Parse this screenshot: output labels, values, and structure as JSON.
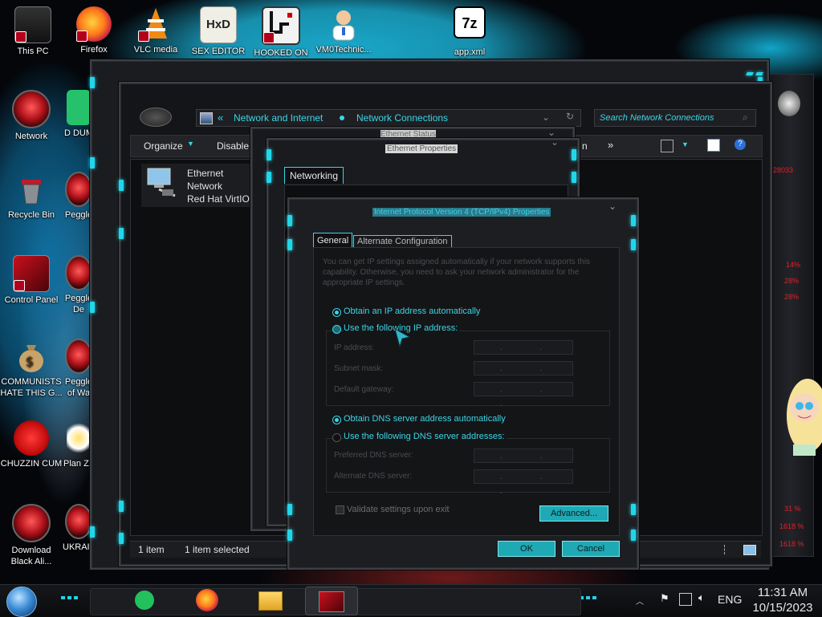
{
  "desktop": {
    "icons": [
      {
        "label": "This PC"
      },
      {
        "label": "Firefox"
      },
      {
        "label": "VLC media"
      },
      {
        "label": "SEX EDITOR"
      },
      {
        "label": "HOOKED ON"
      },
      {
        "label": "VM0Technic..."
      },
      {
        "label": "app.xml"
      },
      {
        "label": "Network"
      },
      {
        "label": "D DUM"
      },
      {
        "label": "Recycle Bin"
      },
      {
        "label": "Peggle"
      },
      {
        "label": "Control Panel"
      },
      {
        "label": "Peggle De"
      },
      {
        "label": "COMMUNISTS HATE THIS G..."
      },
      {
        "label": "Peggle of Wa"
      },
      {
        "label": "CHUZZIN CUM"
      },
      {
        "label": "Plan Zo"
      },
      {
        "label": "Download Black Ali..."
      },
      {
        "label": "UKRAINE"
      }
    ],
    "sevenzip_glyph": "7z",
    "hxd_glyph": "HxD"
  },
  "explorer": {
    "breadcrumb_sep": "«",
    "crumb1": "Network and Internet",
    "crumb2": "Network Connections",
    "search_placeholder": "Search Network Connections",
    "toolbar_organize": "Organize",
    "toolbar_disable": "Disable",
    "toolbar_more": "»",
    "toolbar_m": "n",
    "item": {
      "line1": "Ethernet",
      "line2": "Network",
      "line3": "Red Hat VirtIO E"
    },
    "status_items": "1 item",
    "status_selected": "1 item selected"
  },
  "ethernet_status": {
    "title": "Ethernet Status"
  },
  "ethernet_props": {
    "title": "Ethernet Properties",
    "tab": "Networking"
  },
  "ipv4": {
    "title": "Internet Protocol Version 4 (TCP/IPv4) Properties",
    "tab_general": "General",
    "tab_alternate": "Alternate Configuration",
    "description": "You can get IP settings assigned automatically if your network supports this capability. Otherwise, you need to ask your network administrator for the appropriate IP settings.",
    "opt_auto_ip": "Obtain an IP address automatically",
    "opt_manual_ip": "Use the following IP address:",
    "ip_address_label": "IP address:",
    "subnet_label": "Subnet mask:",
    "gateway_label": "Default gateway:",
    "ip_dots": ". . .",
    "opt_auto_dns": "Obtain DNS server address automatically",
    "opt_manual_dns": "Use the following DNS server addresses:",
    "pref_dns_label": "Preferred DNS server:",
    "alt_dns_label": "Alternate DNS server:",
    "validate_label": "Validate settings upon exit",
    "advanced_button": "Advanced...",
    "ok_button": "OK",
    "cancel_button": "Cancel",
    "selected_ip_option": "auto",
    "selected_dns_option": "auto"
  },
  "side_meters": [
    {
      "label": "28033"
    },
    {
      "label": "14%"
    },
    {
      "label": "28%"
    },
    {
      "label": "28%"
    },
    {
      "label": "31 %"
    },
    {
      "label": "1618 %"
    },
    {
      "label": "1618 %"
    }
  ],
  "taskbar": {
    "language": "ENG",
    "time": "11:31 AM",
    "date": "10/15/2023"
  },
  "colors": {
    "accent": "#3bd5e6",
    "button": "#1fa9b4",
    "window_bg": "#1b1c20"
  }
}
